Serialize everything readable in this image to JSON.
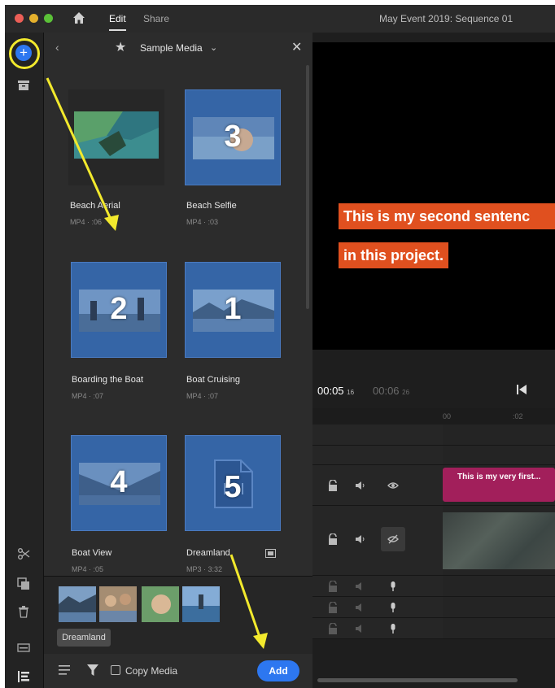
{
  "window": {
    "menu_edit": "Edit",
    "menu_share": "Share",
    "sequence_title": "May Event 2019: Sequence 01"
  },
  "media_panel": {
    "title": "Sample Media",
    "items": [
      {
        "name": "Beach Aerial",
        "meta": "MP4 · :06",
        "number": ""
      },
      {
        "name": "Beach Selfie",
        "meta": "MP4 · :03",
        "number": "3"
      },
      {
        "name": "Boarding the Boat",
        "meta": "MP4 · :07",
        "number": "2"
      },
      {
        "name": "Boat Cruising",
        "meta": "MP4 · :07",
        "number": "1"
      },
      {
        "name": "Boat View",
        "meta": "MP4 · :05",
        "number": "4"
      },
      {
        "name": "Dreamland",
        "meta": "MP3 · 3:32",
        "number": "5"
      }
    ],
    "selected_label": "Dreamland",
    "copy_media_label": "Copy Media",
    "copy_media_checked": false,
    "add_label": "Add"
  },
  "viewer": {
    "caption_line1": "This is my second sentenc",
    "caption_line2": "in this project.",
    "current_time": "00:05",
    "current_frames": "16",
    "duration_time": "00:06",
    "duration_frames": "26"
  },
  "timeline": {
    "ruler_ticks": [
      "00",
      ":02"
    ],
    "title_clip_text": "This is my very first..."
  },
  "colors": {
    "accent_blue": "#2d77f0",
    "annotation_yellow": "#f2e92d",
    "caption_orange": "#e0501f",
    "title_clip_magenta": "#a21f5b"
  }
}
